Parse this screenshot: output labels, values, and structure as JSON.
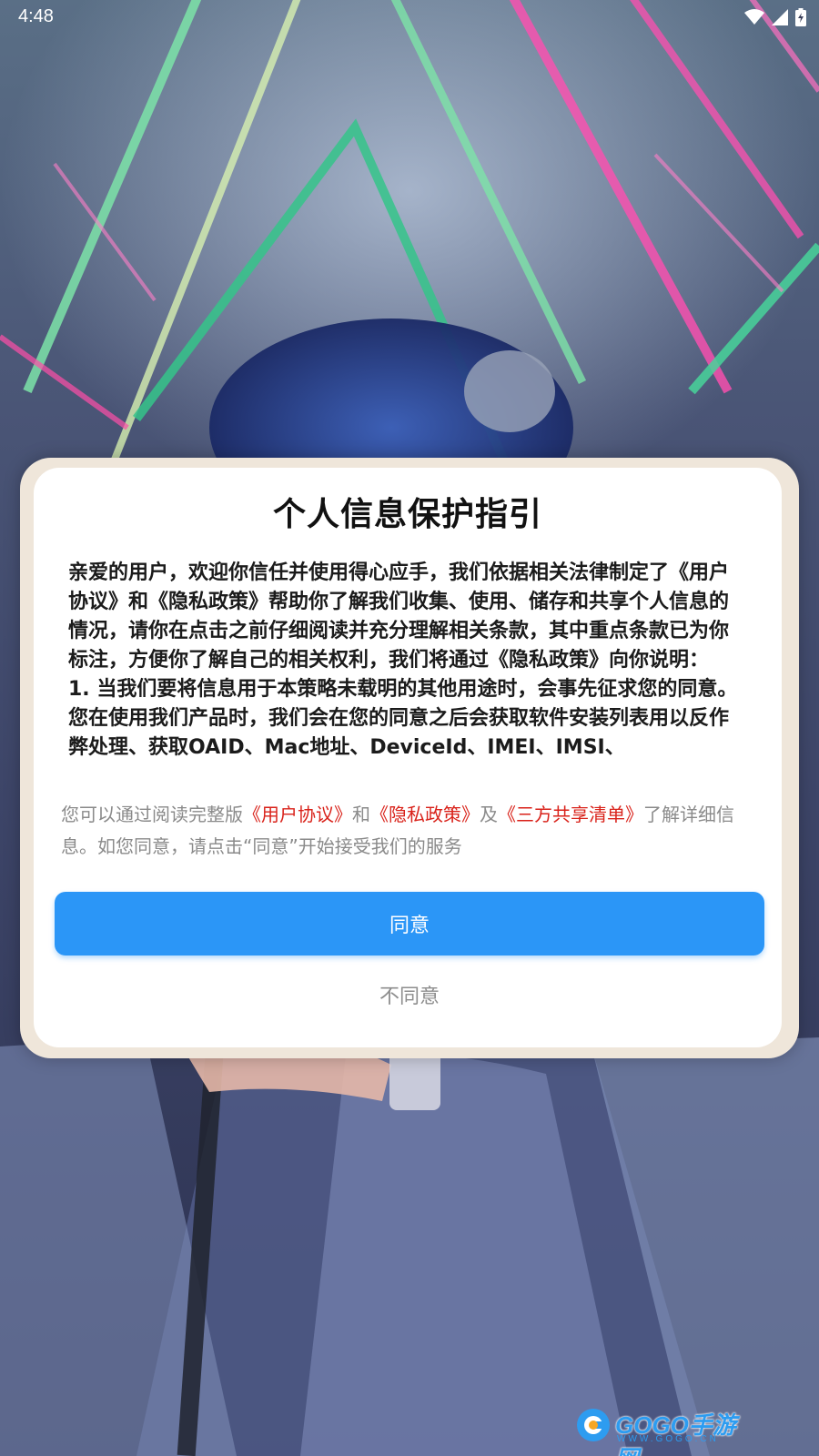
{
  "status_bar": {
    "time": "4:48",
    "icons": [
      "wifi-icon",
      "cell-signal-icon",
      "battery-charging-icon"
    ]
  },
  "dialog": {
    "title": "个人信息保护指引",
    "body_paragraphs": [
      "亲爱的用户，欢迎你信任并使用得心应手，我们依据相关法律制定了《用户协议》和《隐私政策》帮助你了解我们收集、使用、储存和共享个人信息的情况，请你在点击之前仔细阅读并充分理解相关条款，其中重点条款已为你标注，方便你了解自己的相关权利，我们将通过《隐私政策》向你说明：",
      "1. 当我们要将信息用于本策略未载明的其他用途时，会事先征求您的同意。 您在使用我们产品时，我们会在您的同意之后会获取软件安装列表用以反作弊处理、获取OAID、Mac地址、DeviceId、IMEI、IMSI、"
    ],
    "notice": {
      "prefix": "您可以通过阅读完整版",
      "link_user_agreement": "《用户协议》",
      "and": "和",
      "link_privacy_policy": "《隐私政策》",
      "also": "及",
      "link_third_party": "《三方共享清单》",
      "suffix": "了解详细信息。如您同意，请点击“同意”开始接受我们的服务"
    },
    "agree_label": "同意",
    "disagree_label": "不同意"
  },
  "watermark": {
    "brand": "GOGO手游网",
    "url": "WWW.GOGO.CN"
  },
  "colors": {
    "primary_button": "#2b96f7",
    "link_red": "#d9221a",
    "dialog_frame": "#efe6da"
  }
}
